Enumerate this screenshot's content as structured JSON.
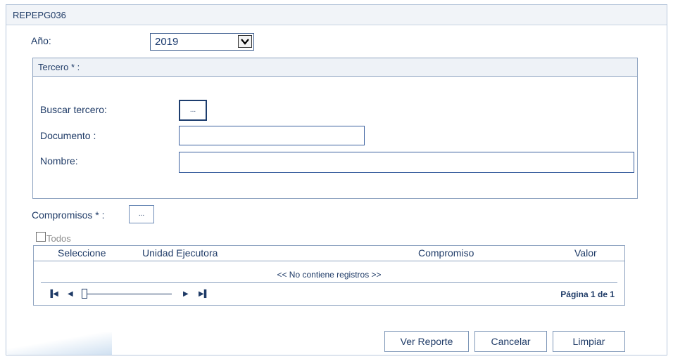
{
  "window": {
    "title": "REPEPG036"
  },
  "year": {
    "label": "Año:",
    "value": "2019"
  },
  "tercero": {
    "section_title": "Tercero * :",
    "buscar_label": "Buscar tercero:",
    "buscar_button": "...",
    "documento_label": "Documento :",
    "documento_value": "",
    "nombre_label": "Nombre:",
    "nombre_value": ""
  },
  "compromisos": {
    "label": "Compromisos * :",
    "button": "...",
    "todos_label": "Todos",
    "todos_checked": false
  },
  "grid": {
    "columns": [
      "Seleccione",
      "Unidad Ejecutora",
      "Compromiso",
      "Valor"
    ],
    "empty_message": "<< No contiene registros >>",
    "page_info": "Página 1 de 1"
  },
  "actions": {
    "ver_reporte": "Ver Reporte",
    "cancelar": "Cancelar",
    "limpiar": "Limpiar"
  },
  "icons": {
    "first": "first-page-icon",
    "prev": "prev-page-icon",
    "next": "next-page-icon",
    "last": "last-page-icon",
    "dropdown": "chevron-down-icon"
  },
  "colors": {
    "text": "#1f3b67",
    "border": "#8ea3c0",
    "header_bg": "#eef2f7"
  }
}
